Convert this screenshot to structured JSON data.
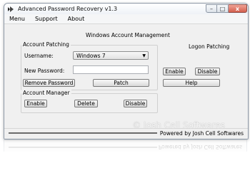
{
  "window": {
    "title": "Advanced Password Recovery v1.3"
  },
  "window_controls": {
    "minimize": "–",
    "maximize": "□",
    "close": "x"
  },
  "menu": {
    "items": [
      "Menu",
      "Support",
      "About"
    ]
  },
  "main": {
    "section_title": "Windows Account Management",
    "account_patching": {
      "title": "Account Patching",
      "username_label": "Username:",
      "username_value": "Windows 7",
      "new_password_label": "New Password:",
      "new_password_value": "",
      "remove_password_button": "Remove Password",
      "patch_button": "Patch"
    },
    "logon_patching": {
      "title": "Logon Patching",
      "enable_button": "Enable",
      "disable_button": "Disable",
      "help_button": "Help"
    },
    "account_manager": {
      "title": "Account Manager",
      "enable_button": "Enable",
      "delete_button": "Delete",
      "disable_button": "Disable"
    }
  },
  "statusbar": {
    "text": "Powered by Josh Cell Softwares"
  },
  "watermark": {
    "text": "© Josh Cell Softwares"
  }
}
